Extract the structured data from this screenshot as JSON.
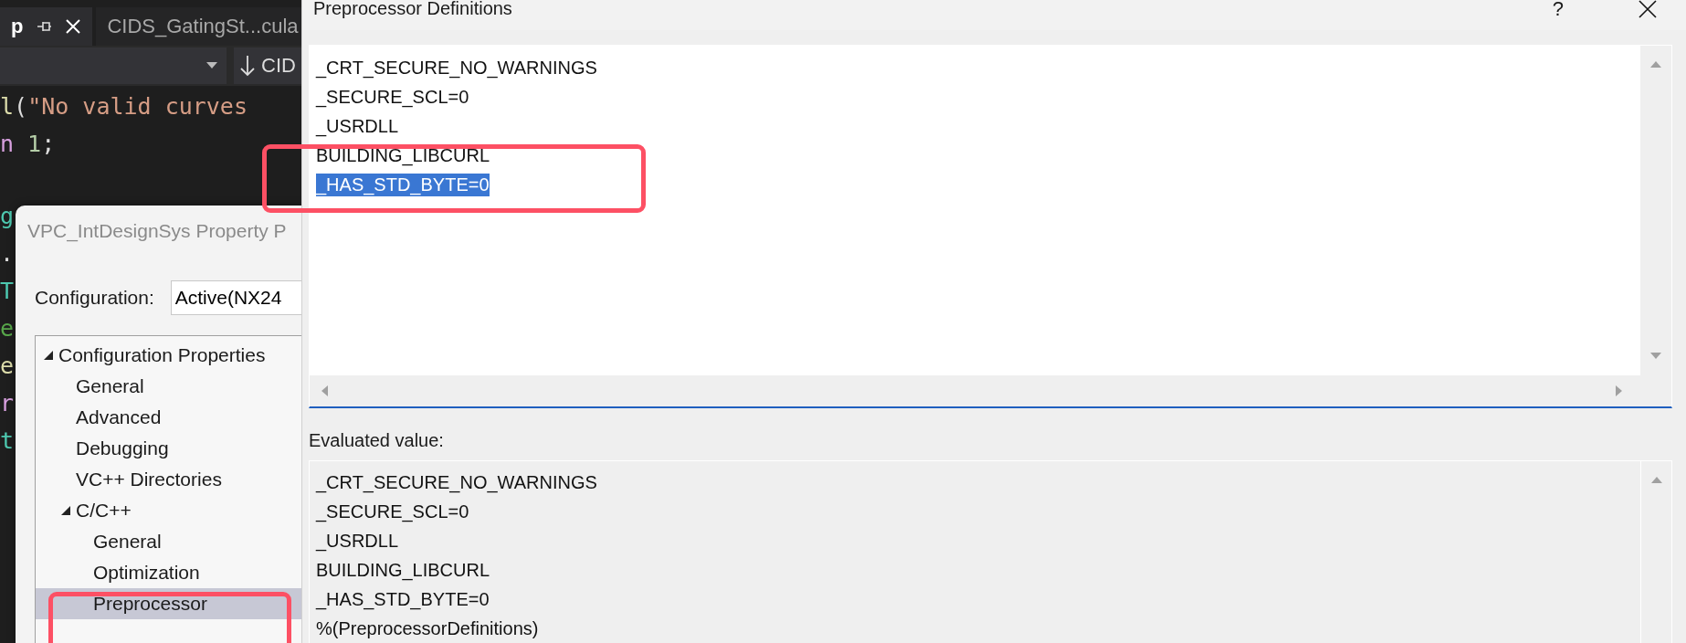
{
  "editor": {
    "tabs": [
      {
        "label": "p",
        "selected": true
      },
      {
        "label": "CIDS_GatingSt...cula",
        "selected": false
      }
    ],
    "navigation": {
      "jump": "CID"
    },
    "code_lines": [
      {
        "tokens": [
          {
            "text": "l",
            "kind": "function"
          },
          {
            "text": "(",
            "kind": "plain"
          },
          {
            "text": "\"No valid curves",
            "kind": "string"
          }
        ]
      },
      {
        "tokens": [
          {
            "text": "n",
            "kind": "keyword"
          },
          {
            "text": " 1",
            "kind": "number"
          },
          {
            "text": ";",
            "kind": "plain"
          }
        ]
      },
      {
        "tokens": [
          {
            "text": "g",
            "kind": "type"
          }
        ]
      },
      {
        "tokens": [
          {
            "text": ".",
            "kind": "plain"
          }
        ]
      },
      {
        "tokens": [
          {
            "text": "T",
            "kind": "type"
          }
        ]
      },
      {
        "tokens": [
          {
            "text": "e",
            "kind": "comment"
          }
        ]
      },
      {
        "tokens": [
          {
            "text": "e",
            "kind": "function"
          }
        ]
      },
      {
        "tokens": [
          {
            "text": "r",
            "kind": "keyword"
          }
        ]
      },
      {
        "tokens": [
          {
            "text": "t",
            "kind": "type"
          }
        ]
      }
    ]
  },
  "property_dialog": {
    "title": "VPC_IntDesignSys Property P",
    "configuration_label": "Configuration:",
    "configuration_value": "Active(NX24",
    "tree": [
      {
        "label": "Configuration Properties",
        "expanded": true,
        "selected": false,
        "children": [
          {
            "label": "General",
            "selected": false
          },
          {
            "label": "Advanced",
            "selected": false
          },
          {
            "label": "Debugging",
            "selected": false
          },
          {
            "label": "VC++ Directories",
            "selected": false
          },
          {
            "label": "C/C++",
            "expanded": true,
            "selected": false,
            "children": [
              {
                "label": "General",
                "selected": false
              },
              {
                "label": "Optimization",
                "selected": false
              },
              {
                "label": "Preprocessor",
                "selected": true
              }
            ]
          }
        ]
      }
    ]
  },
  "preprocessor_dialog": {
    "title": "Preprocessor Definitions",
    "help": "?",
    "definitions": [
      {
        "text": "_CRT_SECURE_NO_WARNINGS",
        "selected": false
      },
      {
        "text": "_SECURE_SCL=0",
        "selected": false
      },
      {
        "text": "_USRDLL",
        "selected": false
      },
      {
        "text": "BUILDING_LIBCURL",
        "selected": false
      },
      {
        "text": "_HAS_STD_BYTE=0",
        "selected": true
      }
    ],
    "evaluated_label": "Evaluated value:",
    "evaluated": [
      "_CRT_SECURE_NO_WARNINGS",
      "_SECURE_SCL=0",
      "_USRDLL",
      "BUILDING_LIBCURL",
      "_HAS_STD_BYTE=0",
      "%(PreprocessorDefinitions)"
    ]
  }
}
